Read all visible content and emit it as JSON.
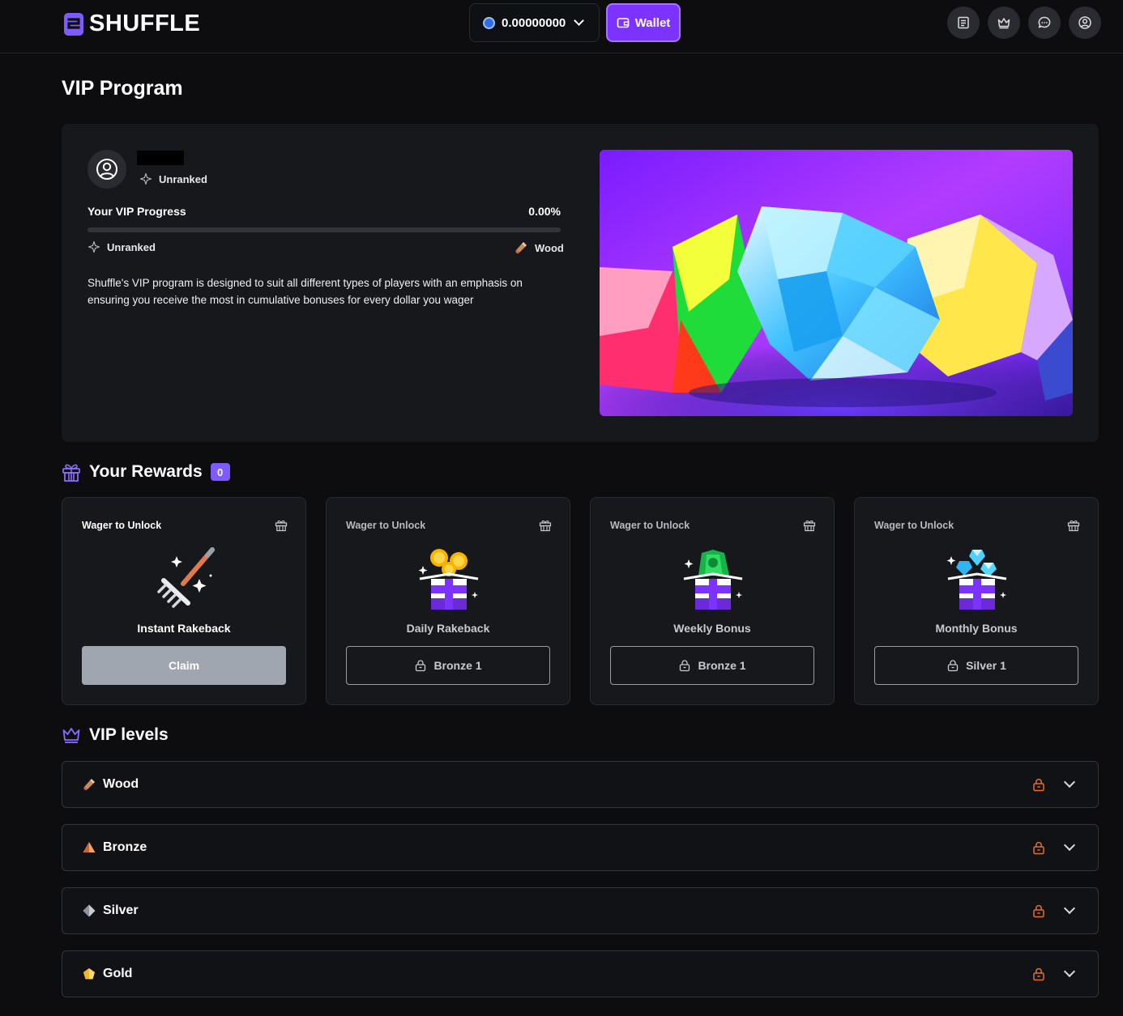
{
  "header": {
    "brand": "SHUFFLE",
    "balance": "0.00000000",
    "wallet_label": "Wallet"
  },
  "page": {
    "title": "VIP Program"
  },
  "profile": {
    "rank": "Unranked",
    "progress_label": "Your VIP Progress",
    "progress_pct": "0.00%",
    "progress_value": 0,
    "current_tier": "Unranked",
    "next_tier": "Wood",
    "description": "Shuffle's VIP program is designed to suit all different types of players with an emphasis on ensuring you receive the most in cumulative bonuses for every dollar you wager"
  },
  "rewards": {
    "title": "Your Rewards",
    "count": "0",
    "cards": [
      {
        "label": "Wager to Unlock",
        "name": "Instant Rakeback",
        "button": "Claim",
        "state": "claim"
      },
      {
        "label": "Wager to Unlock",
        "name": "Daily Rakeback",
        "button": "Bronze 1",
        "state": "locked"
      },
      {
        "label": "Wager to Unlock",
        "name": "Weekly Bonus",
        "button": "Bronze 1",
        "state": "locked"
      },
      {
        "label": "Wager to Unlock",
        "name": "Monthly Bonus",
        "button": "Silver 1",
        "state": "locked"
      }
    ]
  },
  "levels": {
    "title": "VIP levels",
    "items": [
      {
        "name": "Wood",
        "icon": "wood-icon"
      },
      {
        "name": "Bronze",
        "icon": "bronze-icon"
      },
      {
        "name": "Silver",
        "icon": "silver-icon"
      },
      {
        "name": "Gold",
        "icon": "gold-icon"
      }
    ]
  },
  "colors": {
    "accent": "#7d33ff",
    "lock": "#e0702a"
  }
}
